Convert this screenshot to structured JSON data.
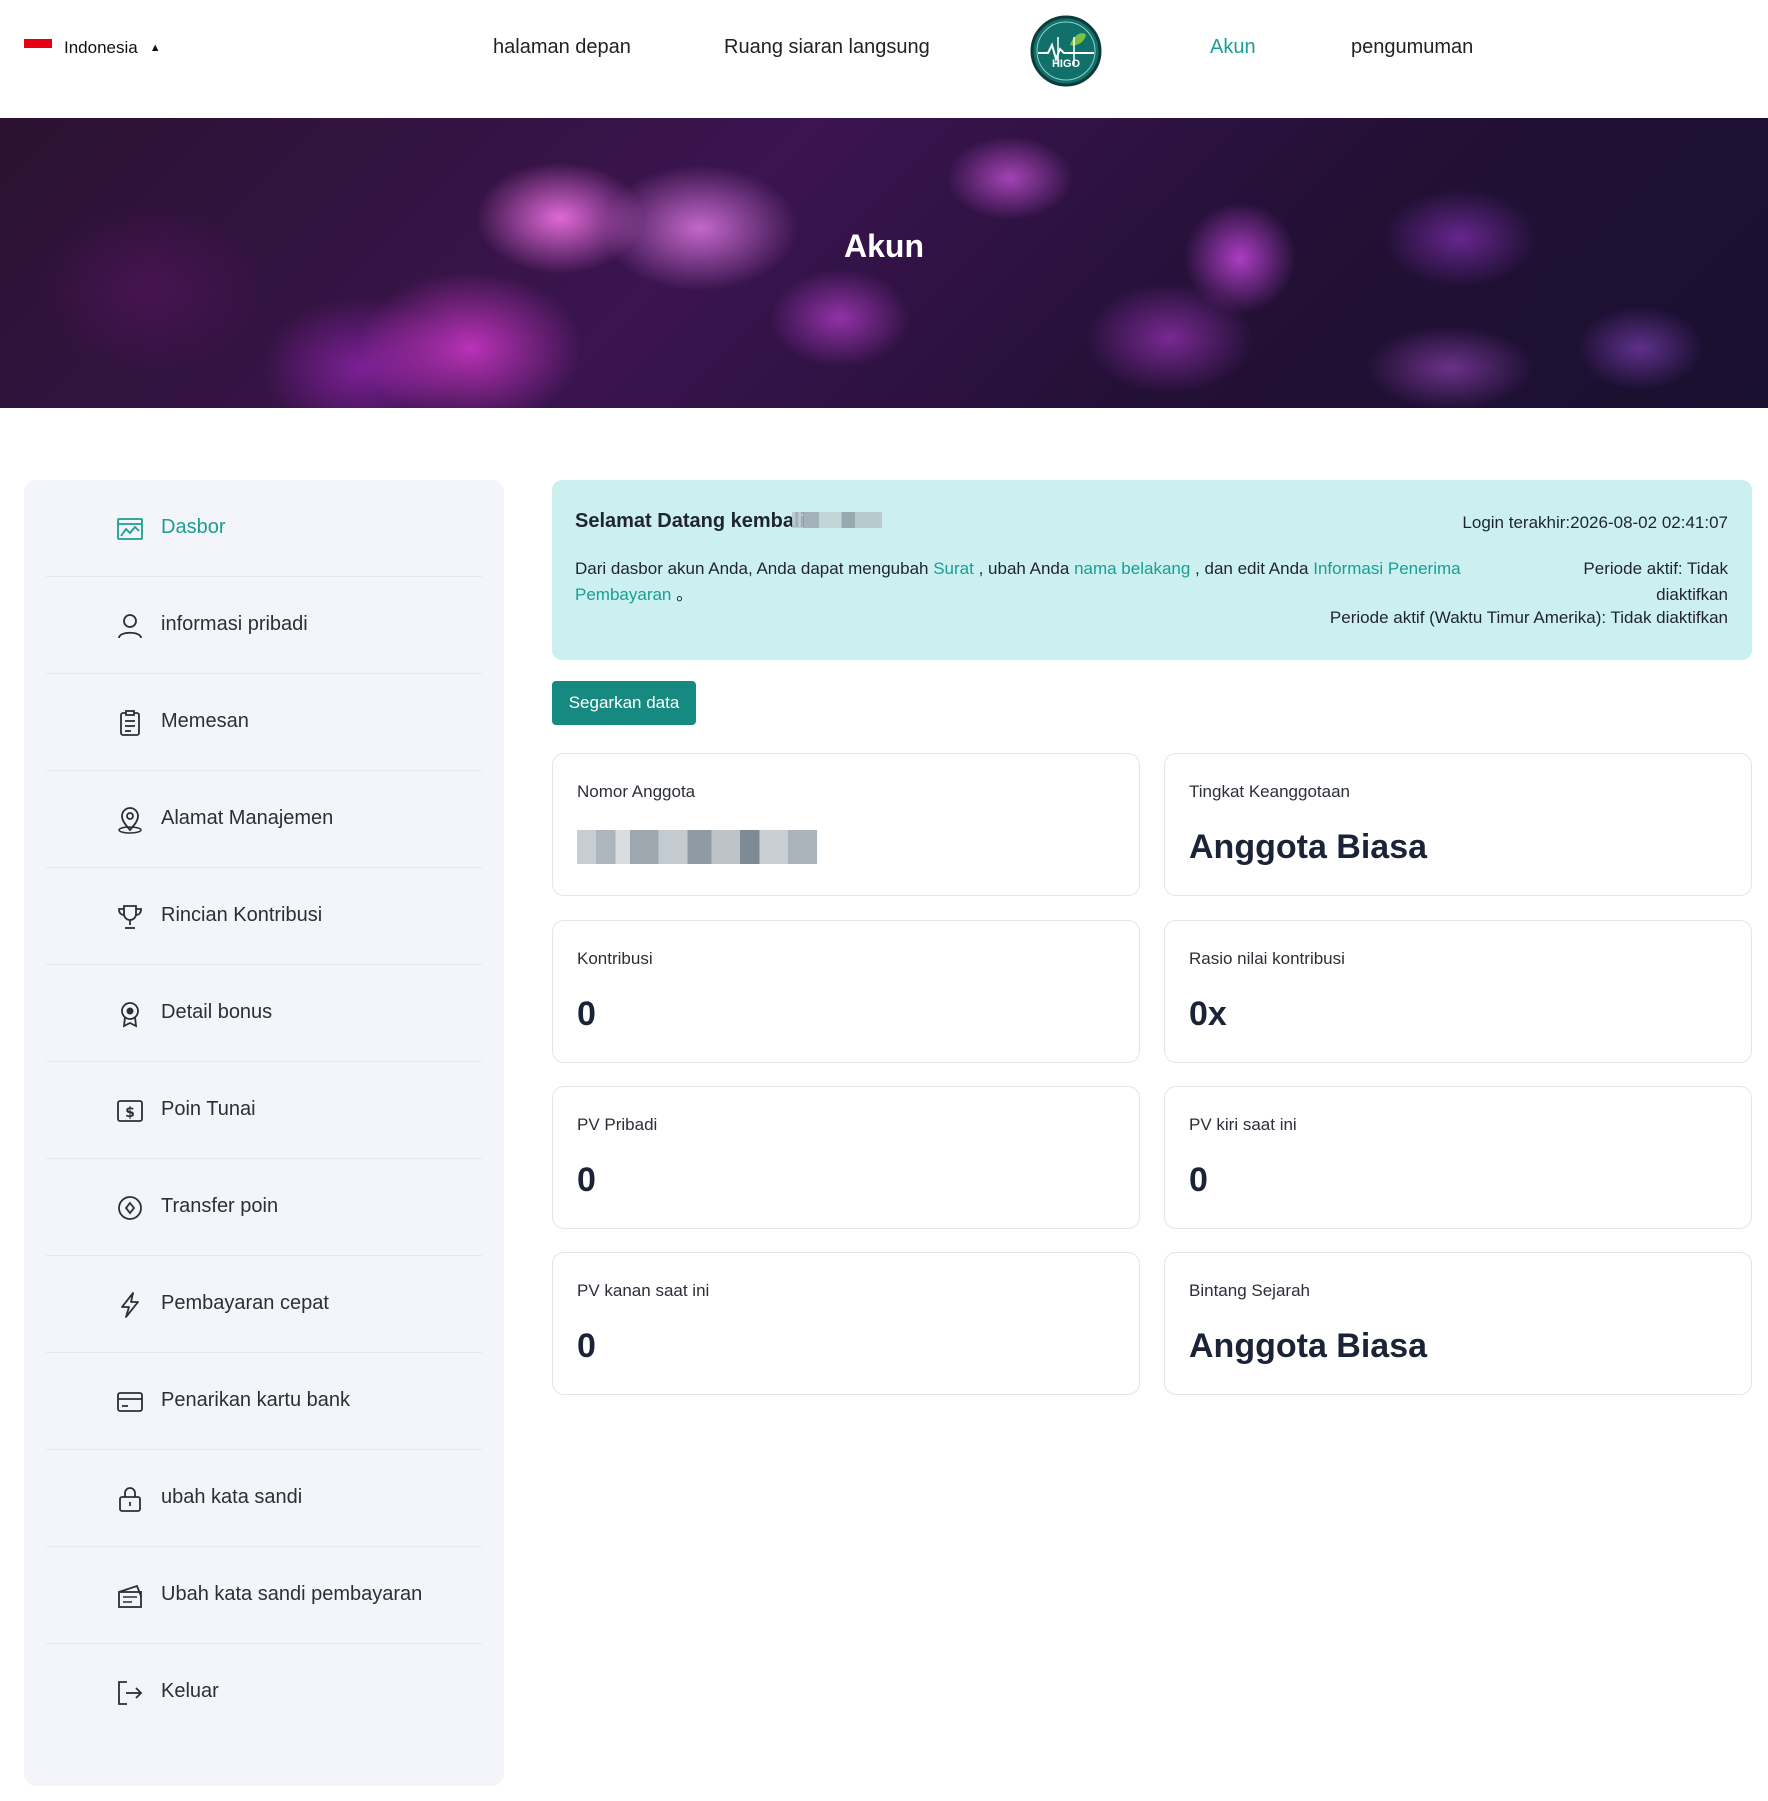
{
  "header": {
    "language": "Indonesia",
    "nav": [
      {
        "label": "halaman depan"
      },
      {
        "label": "Ruang siaran langsung"
      },
      {
        "label": "Akun"
      },
      {
        "label": "pengumuman"
      }
    ],
    "logo_text": "HIGO",
    "active_color": "#1a9e93"
  },
  "banner": {
    "title": "Akun"
  },
  "sidebar": {
    "items": [
      {
        "label": "Dasbor",
        "icon": "dashboard-icon"
      },
      {
        "label": "informasi pribadi",
        "icon": "user-icon"
      },
      {
        "label": "Memesan",
        "icon": "clipboard-icon"
      },
      {
        "label": "Alamat Manajemen",
        "icon": "location-icon"
      },
      {
        "label": "Rincian Kontribusi",
        "icon": "trophy-icon"
      },
      {
        "label": "Detail bonus",
        "icon": "award-icon"
      },
      {
        "label": "Poin Tunai",
        "icon": "dollar-icon"
      },
      {
        "label": "Transfer poin",
        "icon": "transfer-icon"
      },
      {
        "label": "Pembayaran cepat",
        "icon": "lightning-icon"
      },
      {
        "label": "Penarikan kartu bank",
        "icon": "card-icon"
      },
      {
        "label": "ubah kata sandi",
        "icon": "lock-icon"
      },
      {
        "label": "Ubah kata sandi pembayaran",
        "icon": "payment-password-icon"
      },
      {
        "label": "Keluar",
        "icon": "logout-icon"
      }
    ]
  },
  "welcome": {
    "title": "Selamat Datang kembali",
    "login": "Login terakhir:2026-08-02 02:41:07",
    "desc_pre": "Dari dasbor akun Anda, Anda dapat mengubah ",
    "link_surat": "Surat",
    "desc_mid1": " , ubah Anda ",
    "link_name": "nama belakang",
    "desc_mid2": " , dan edit Anda ",
    "link_payment": "Informasi Penerima Pembayaran",
    "desc_end": " 。",
    "period": "Periode aktif: Tidak diaktifkan",
    "period_est": "Periode aktif (Waktu Timur Amerika): Tidak diaktifkan"
  },
  "refresh_label": "Segarkan data",
  "cards": [
    {
      "label": "Nomor Anggota",
      "value": ""
    },
    {
      "label": "Tingkat Keanggotaan",
      "value": "Anggota Biasa"
    },
    {
      "label": "Kontribusi",
      "value": "0"
    },
    {
      "label": "Rasio nilai kontribusi",
      "value": "0x"
    },
    {
      "label": "PV Pribadi",
      "value": "0"
    },
    {
      "label": "PV kiri saat ini",
      "value": "0"
    },
    {
      "label": "PV kanan saat ini",
      "value": "0"
    },
    {
      "label": "Bintang Sejarah",
      "value": "Anggota Biasa"
    }
  ]
}
